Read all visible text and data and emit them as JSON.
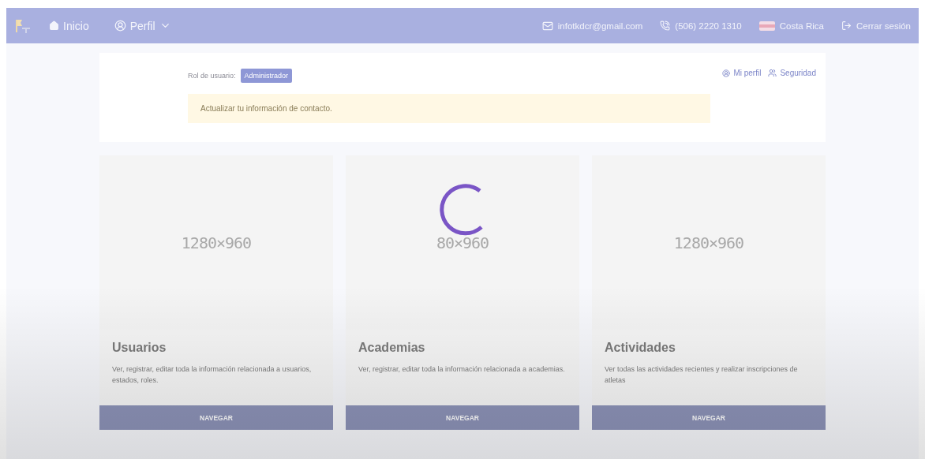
{
  "navbar": {
    "links": [
      {
        "kind": "home",
        "label": "Inicio"
      },
      {
        "kind": "profile",
        "label": "Perfil"
      }
    ],
    "contacts": [
      {
        "kind": "email",
        "label": "infotkdcr@gmail.com"
      },
      {
        "kind": "phone",
        "label": "(506) 2220 1310"
      },
      {
        "kind": "country",
        "label": "Costa Rica"
      },
      {
        "kind": "logout",
        "label": "Cerrar sesión"
      }
    ]
  },
  "profile": {
    "role_label": "Rol de usuario:",
    "role": "Administrador",
    "alert": "Actualizar tu información de contacto.",
    "links": [
      {
        "kind": "profile",
        "label": "Mi perfil"
      },
      {
        "kind": "security",
        "label": "Seguridad"
      }
    ]
  },
  "cards": [
    {
      "image_text": "1280×960",
      "title": "Usuarios",
      "description": "Ver, registrar, editar toda la información relacionada a usuarios, estados, roles.",
      "button": "NAVEGAR"
    },
    {
      "image_text": "80×960",
      "title": "Academias",
      "description": "Ver, registrar, editar toda la información relacionada a academias.",
      "button": "NAVEGAR"
    },
    {
      "image_text": "1280×960",
      "title": "Actividades",
      "description": "Ver todas las actividades recientes y realizar inscripciones de atletas",
      "button": "NAVEGAR"
    }
  ],
  "loading": true
}
